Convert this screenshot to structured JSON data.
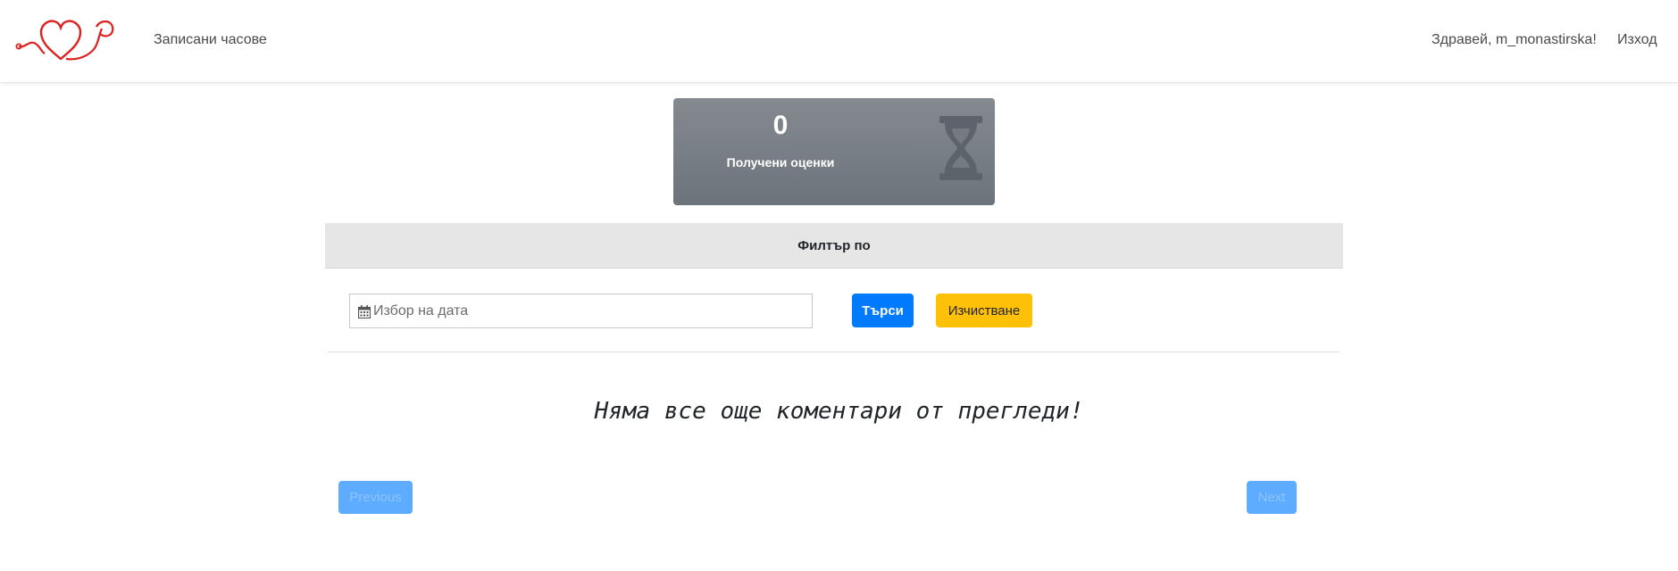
{
  "navbar": {
    "logo_icon": "heart-stethoscope-logo",
    "link_appointments": "Записани часове",
    "greeting": "Здравей, m_monastirska!",
    "logout": "Изход"
  },
  "stats": {
    "value": "0",
    "label": "Получени оценки",
    "icon": "hourglass-icon",
    "color": "#6c737b"
  },
  "filter": {
    "header": "Филтър по",
    "date_placeholder": "Избор на дата",
    "date_value": "",
    "search_label": "Търси",
    "clear_label": "Изчистване",
    "search_color": "#007bff",
    "clear_color": "#ffc107"
  },
  "content": {
    "empty_message": "Няма все още коментари от прегледи!"
  },
  "pagination": {
    "previous": "Previous",
    "next": "Next"
  }
}
